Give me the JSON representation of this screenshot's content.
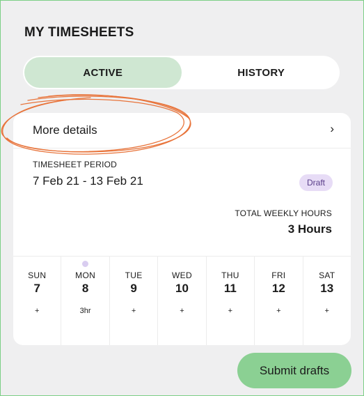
{
  "header": {
    "title": "MY TIMESHEETS"
  },
  "tabs": [
    {
      "label": "ACTIVE",
      "active": true
    },
    {
      "label": "HISTORY",
      "active": false
    }
  ],
  "card": {
    "details_label": "More details",
    "details_chevron": "›",
    "period_label": "TIMESHEET PERIOD",
    "period_value": "7 Feb 21 - 13 Feb 21",
    "status_badge": "Draft",
    "total_hours_label": "TOTAL WEEKLY HOURS",
    "total_hours_value": "3 Hours"
  },
  "days": [
    {
      "name": "SUN",
      "date": "7",
      "value": "+"
    },
    {
      "name": "MON",
      "date": "8",
      "value": "3hr"
    },
    {
      "name": "TUE",
      "date": "9",
      "value": "+"
    },
    {
      "name": "WED",
      "date": "10",
      "value": "+"
    },
    {
      "name": "THU",
      "date": "11",
      "value": "+"
    },
    {
      "name": "FRI",
      "date": "12",
      "value": "+"
    },
    {
      "name": "SAT",
      "date": "13",
      "value": "+"
    }
  ],
  "actions": {
    "submit_label": "Submit drafts"
  },
  "colors": {
    "accent_green": "#8bd093",
    "tab_active": "#cfe7d2",
    "badge_bg": "#e7dcf6",
    "annotation": "#e8743b"
  }
}
